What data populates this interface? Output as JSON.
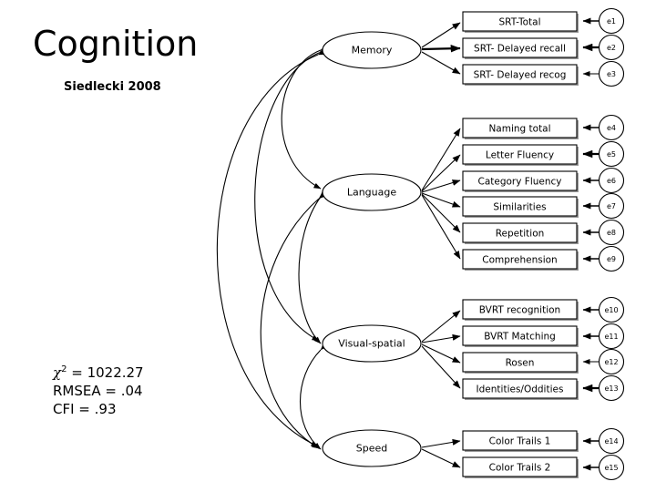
{
  "slide": {
    "title": "Cognition",
    "subtitle": "Siedlecki 2008"
  },
  "fit_statistics": {
    "chi_symbol": "χ",
    "chi_exponent": "2",
    "chi_line": " = 1022.27",
    "rmsea": "RMSEA = .04",
    "cfi": "CFI = .93"
  },
  "factors": [
    {
      "id": "memory",
      "label": "Memory"
    },
    {
      "id": "language",
      "label": "Language"
    },
    {
      "id": "visual_spatial",
      "label": "Visual-spatial"
    },
    {
      "id": "speed",
      "label": "Speed"
    }
  ],
  "indicators": [
    {
      "factor": "memory",
      "label": "SRT-Total",
      "error": "e1"
    },
    {
      "factor": "memory",
      "label": "SRT- Delayed recall",
      "error": "e2"
    },
    {
      "factor": "memory",
      "label": "SRT- Delayed recog",
      "error": "e3"
    },
    {
      "factor": "language",
      "label": "Naming total",
      "error": "e4"
    },
    {
      "factor": "language",
      "label": "Letter Fluency",
      "error": "e5"
    },
    {
      "factor": "language",
      "label": "Category Fluency",
      "error": "e6"
    },
    {
      "factor": "language",
      "label": "Similarities",
      "error": "e7"
    },
    {
      "factor": "language",
      "label": "Repetition",
      "error": "e8"
    },
    {
      "factor": "language",
      "label": "Comprehension",
      "error": "e9"
    },
    {
      "factor": "visual_spatial",
      "label": "BVRT recognition",
      "error": "e10"
    },
    {
      "factor": "visual_spatial",
      "label": "BVRT Matching",
      "error": "e11"
    },
    {
      "factor": "visual_spatial",
      "label": "Rosen",
      "error": "e12"
    },
    {
      "factor": "visual_spatial",
      "label": "Identities/Oddities",
      "error": "e13"
    },
    {
      "factor": "speed",
      "label": "Color Trails 1",
      "error": "e14"
    },
    {
      "factor": "speed",
      "label": "Color Trails 2",
      "error": "e15"
    }
  ],
  "covariances": [
    {
      "from": "memory",
      "to": "language"
    },
    {
      "from": "memory",
      "to": "visual_spatial"
    },
    {
      "from": "memory",
      "to": "speed"
    },
    {
      "from": "language",
      "to": "visual_spatial"
    },
    {
      "from": "language",
      "to": "speed"
    },
    {
      "from": "visual_spatial",
      "to": "speed"
    }
  ],
  "colors": {
    "stroke": "#000000",
    "fill": "#ffffff",
    "shadow": "#9a9a9a",
    "text": "#000000"
  }
}
